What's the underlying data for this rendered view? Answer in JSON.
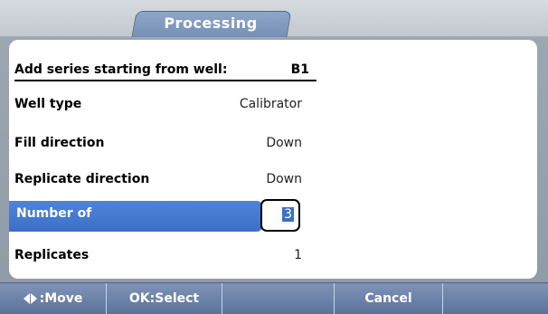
{
  "tabs": {
    "active": "Processing"
  },
  "form": {
    "header_label": "Add series starting from well:",
    "header_value": "B1",
    "rows": [
      {
        "label": "Well type",
        "value": "Calibrator"
      },
      {
        "label": "Fill direction",
        "value": "Down"
      },
      {
        "label": "Replicate direction",
        "value": "Down"
      }
    ],
    "number_of": {
      "label": "Number of",
      "value": "3"
    },
    "replicates": {
      "label": "Replicates",
      "value": "1"
    }
  },
  "softkeys": {
    "move": ":Move",
    "select": "OK:Select",
    "blank1": "",
    "cancel": "Cancel",
    "blank2": ""
  },
  "colors": {
    "highlight": "#3d6fc7",
    "tab": "#7690b5",
    "softkey_bar": "#5d729a"
  }
}
